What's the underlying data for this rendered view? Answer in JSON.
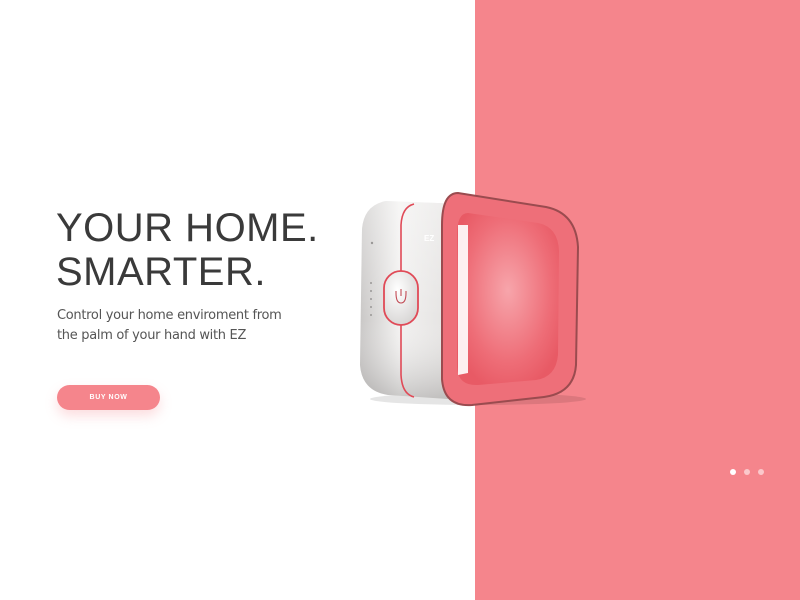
{
  "hero": {
    "title_line1": "YOUR HOME.",
    "title_line2": "SMARTER.",
    "subtitle": "Control your home enviroment from the palm of your hand with EZ",
    "cta_label": "BUY NOW"
  },
  "device": {
    "brand_label": "EZ",
    "button_icon": "power-icon",
    "indicator_count": 5
  },
  "pager": {
    "count": 3,
    "active_index": 0
  },
  "colors": {
    "accent": "#f5858c",
    "device_inner": "#ee6a74",
    "device_body": "#e7e5e4",
    "text_dark": "#3a3a3a"
  }
}
